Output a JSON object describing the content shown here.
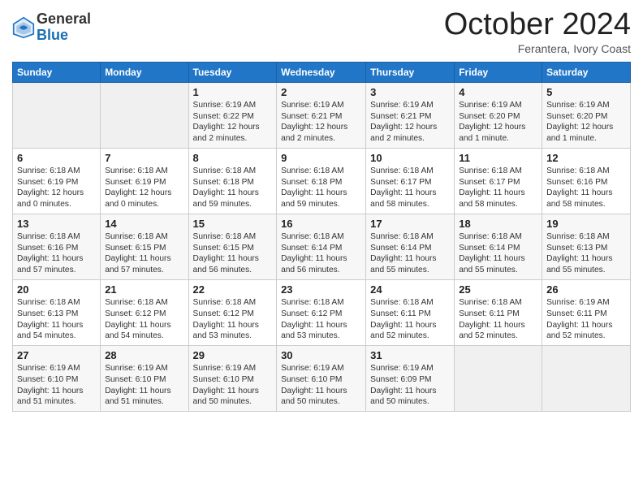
{
  "header": {
    "logo_general": "General",
    "logo_blue": "Blue",
    "month_title": "October 2024",
    "subtitle": "Ferantera, Ivory Coast"
  },
  "days_of_week": [
    "Sunday",
    "Monday",
    "Tuesday",
    "Wednesday",
    "Thursday",
    "Friday",
    "Saturday"
  ],
  "weeks": [
    [
      {
        "day": "",
        "info": ""
      },
      {
        "day": "",
        "info": ""
      },
      {
        "day": "1",
        "info": "Sunrise: 6:19 AM\nSunset: 6:22 PM\nDaylight: 12 hours and 2 minutes."
      },
      {
        "day": "2",
        "info": "Sunrise: 6:19 AM\nSunset: 6:21 PM\nDaylight: 12 hours and 2 minutes."
      },
      {
        "day": "3",
        "info": "Sunrise: 6:19 AM\nSunset: 6:21 PM\nDaylight: 12 hours and 2 minutes."
      },
      {
        "day": "4",
        "info": "Sunrise: 6:19 AM\nSunset: 6:20 PM\nDaylight: 12 hours and 1 minute."
      },
      {
        "day": "5",
        "info": "Sunrise: 6:19 AM\nSunset: 6:20 PM\nDaylight: 12 hours and 1 minute."
      }
    ],
    [
      {
        "day": "6",
        "info": "Sunrise: 6:18 AM\nSunset: 6:19 PM\nDaylight: 12 hours and 0 minutes."
      },
      {
        "day": "7",
        "info": "Sunrise: 6:18 AM\nSunset: 6:19 PM\nDaylight: 12 hours and 0 minutes."
      },
      {
        "day": "8",
        "info": "Sunrise: 6:18 AM\nSunset: 6:18 PM\nDaylight: 11 hours and 59 minutes."
      },
      {
        "day": "9",
        "info": "Sunrise: 6:18 AM\nSunset: 6:18 PM\nDaylight: 11 hours and 59 minutes."
      },
      {
        "day": "10",
        "info": "Sunrise: 6:18 AM\nSunset: 6:17 PM\nDaylight: 11 hours and 58 minutes."
      },
      {
        "day": "11",
        "info": "Sunrise: 6:18 AM\nSunset: 6:17 PM\nDaylight: 11 hours and 58 minutes."
      },
      {
        "day": "12",
        "info": "Sunrise: 6:18 AM\nSunset: 6:16 PM\nDaylight: 11 hours and 58 minutes."
      }
    ],
    [
      {
        "day": "13",
        "info": "Sunrise: 6:18 AM\nSunset: 6:16 PM\nDaylight: 11 hours and 57 minutes."
      },
      {
        "day": "14",
        "info": "Sunrise: 6:18 AM\nSunset: 6:15 PM\nDaylight: 11 hours and 57 minutes."
      },
      {
        "day": "15",
        "info": "Sunrise: 6:18 AM\nSunset: 6:15 PM\nDaylight: 11 hours and 56 minutes."
      },
      {
        "day": "16",
        "info": "Sunrise: 6:18 AM\nSunset: 6:14 PM\nDaylight: 11 hours and 56 minutes."
      },
      {
        "day": "17",
        "info": "Sunrise: 6:18 AM\nSunset: 6:14 PM\nDaylight: 11 hours and 55 minutes."
      },
      {
        "day": "18",
        "info": "Sunrise: 6:18 AM\nSunset: 6:14 PM\nDaylight: 11 hours and 55 minutes."
      },
      {
        "day": "19",
        "info": "Sunrise: 6:18 AM\nSunset: 6:13 PM\nDaylight: 11 hours and 55 minutes."
      }
    ],
    [
      {
        "day": "20",
        "info": "Sunrise: 6:18 AM\nSunset: 6:13 PM\nDaylight: 11 hours and 54 minutes."
      },
      {
        "day": "21",
        "info": "Sunrise: 6:18 AM\nSunset: 6:12 PM\nDaylight: 11 hours and 54 minutes."
      },
      {
        "day": "22",
        "info": "Sunrise: 6:18 AM\nSunset: 6:12 PM\nDaylight: 11 hours and 53 minutes."
      },
      {
        "day": "23",
        "info": "Sunrise: 6:18 AM\nSunset: 6:12 PM\nDaylight: 11 hours and 53 minutes."
      },
      {
        "day": "24",
        "info": "Sunrise: 6:18 AM\nSunset: 6:11 PM\nDaylight: 11 hours and 52 minutes."
      },
      {
        "day": "25",
        "info": "Sunrise: 6:18 AM\nSunset: 6:11 PM\nDaylight: 11 hours and 52 minutes."
      },
      {
        "day": "26",
        "info": "Sunrise: 6:19 AM\nSunset: 6:11 PM\nDaylight: 11 hours and 52 minutes."
      }
    ],
    [
      {
        "day": "27",
        "info": "Sunrise: 6:19 AM\nSunset: 6:10 PM\nDaylight: 11 hours and 51 minutes."
      },
      {
        "day": "28",
        "info": "Sunrise: 6:19 AM\nSunset: 6:10 PM\nDaylight: 11 hours and 51 minutes."
      },
      {
        "day": "29",
        "info": "Sunrise: 6:19 AM\nSunset: 6:10 PM\nDaylight: 11 hours and 50 minutes."
      },
      {
        "day": "30",
        "info": "Sunrise: 6:19 AM\nSunset: 6:10 PM\nDaylight: 11 hours and 50 minutes."
      },
      {
        "day": "31",
        "info": "Sunrise: 6:19 AM\nSunset: 6:09 PM\nDaylight: 11 hours and 50 minutes."
      },
      {
        "day": "",
        "info": ""
      },
      {
        "day": "",
        "info": ""
      }
    ]
  ]
}
